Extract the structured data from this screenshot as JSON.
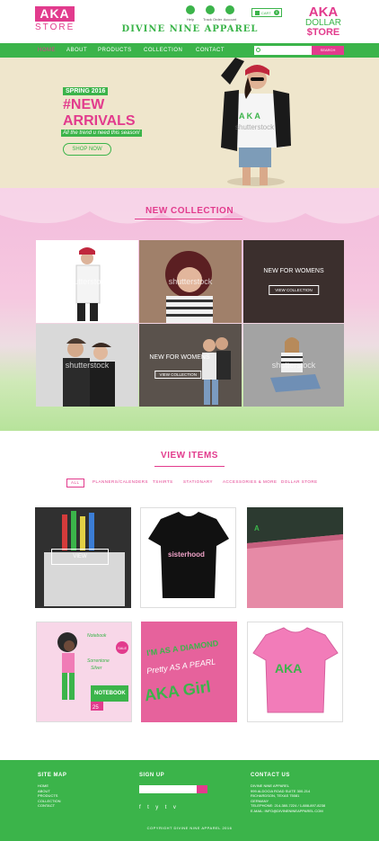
{
  "header": {
    "logo_left": {
      "line1": "AKA",
      "line2": "STORE"
    },
    "icons": [
      {
        "icon": "help-icon",
        "label": "Help"
      },
      {
        "icon": "location-pin-icon",
        "label": "Track Order"
      },
      {
        "icon": "account-icon",
        "label": "Account"
      }
    ],
    "cart": {
      "label": "CART",
      "count": "0"
    },
    "brand": "DIVINE NINE APPAREL",
    "logo_right": {
      "line1": "AKA",
      "line2": "DOLLAR",
      "line3": "$TORE"
    }
  },
  "nav": {
    "items": [
      "HOME",
      "ABOUT",
      "PRODUCTS",
      "COLLECTION",
      "CONTACT"
    ],
    "search_button": "SEARCH"
  },
  "hero": {
    "tag": "SPRING 2016",
    "title_line1": "#NEW",
    "title_line2": "ARRIVALS",
    "subtitle": "All the trend u need this season!",
    "button": "SHOP NOW"
  },
  "collection": {
    "title": "NEW COLLECTION",
    "watermark": "shutterstock",
    "tile_caption": "NEW FOR WOMENS",
    "tile_button": "VIEW COLLECTION"
  },
  "view_items": {
    "title": "VIEW ITEMS",
    "filters": [
      "ALL",
      "PLANNERS/CALENDERS",
      "TSHIRTS",
      "STATIONARY",
      "ACCESSORIES & MORE",
      "DOLLAR STORE"
    ],
    "view_button": "VIEW",
    "product_text": {
      "tshirt_black": "sisterhood",
      "notebook_script": "Notebook",
      "notebook_line1": "Sorrentone",
      "notebook_line2": "Silver",
      "notebook_title": "NOTEBOOK",
      "notebook_num": "25",
      "sale_badge": "SALE",
      "pink_shirt_line1": "I'M AS A DIAMOND",
      "pink_shirt_line2": "Pretty AS A PEARL",
      "pink_shirt_line3": "AKA Girl",
      "tee_letters": "AKA"
    }
  },
  "footer": {
    "sitemap_title": "SITE MAP",
    "sitemap_links": [
      "HOME",
      "ABOUT",
      "PRODUCTS",
      "COLLECTION",
      "CONTACT"
    ],
    "signup_title": "SIGN UP",
    "social": [
      "f",
      "t",
      "y",
      "t",
      "v"
    ],
    "contact_title": "CONTACT US",
    "contact_lines": [
      "DIVINE NINE APPAREL",
      "999 ALDOCIA ROAD SUITE 300-214",
      "RICHARDSON, TEXAS 75081",
      "GERMANY",
      "TELEPHONE: 214-380-7224 / 1-888-897-8238",
      "E-MAIL: INFO@DIVINENINEAPPAREL.COM"
    ],
    "copyright": "COPYRIGHT DIVINE NINE APPAREL 2016"
  }
}
